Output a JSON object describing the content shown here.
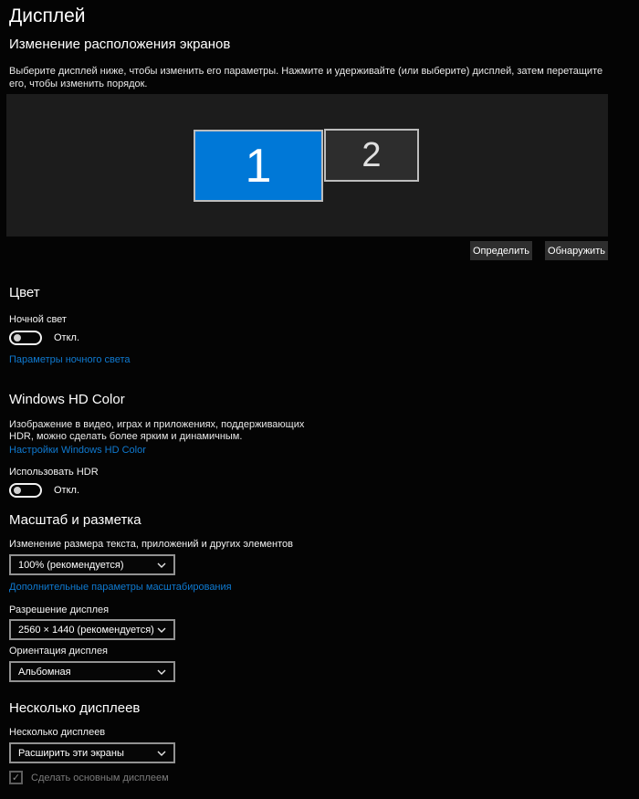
{
  "page": {
    "title": "Дисплей",
    "background": "#040404",
    "panel_color": "#1c1c1c",
    "accent_color": "#0078d7",
    "link_color": "#0f7ad1"
  },
  "arrange": {
    "heading": "Изменение расположения экранов",
    "description": "Выберите дисплей ниже, чтобы изменить его параметры. Нажмите и удерживайте (или выберите) дисплей, затем перетащите его, чтобы изменить порядок.",
    "monitors": [
      {
        "number": "1",
        "selected": true,
        "color": "#0078d7"
      },
      {
        "number": "2",
        "selected": false,
        "color": "#2d2d2d"
      }
    ],
    "identify_button": "Определить",
    "detect_button": "Обнаружить"
  },
  "color_section": {
    "heading": "Цвет",
    "night_light": {
      "label": "Ночной свет",
      "state": "Откл.",
      "on": false
    },
    "link": "Параметры ночного света"
  },
  "hd_color": {
    "heading": "Windows HD Color",
    "description_line1": "Изображение в видео, играх и приложениях, поддерживающих",
    "description_line2": "HDR, можно сделать более ярким и динамичным.",
    "link": "Настройки Windows HD Color",
    "use_hdr": {
      "label": "Использовать HDR",
      "state": "Откл.",
      "on": false
    }
  },
  "scale_layout": {
    "heading": "Масштаб и разметка",
    "scale": {
      "label": "Изменение размера текста, приложений и других элементов",
      "value": "100% (рекомендуется)"
    },
    "link": "Дополнительные параметры масштабирования",
    "resolution": {
      "label": "Разрешение дисплея",
      "value": "2560 × 1440 (рекомендуется)"
    },
    "orientation": {
      "label": "Ориентация дисплея",
      "value": "Альбомная"
    }
  },
  "multiple_displays": {
    "heading": "Несколько дисплеев",
    "mode": {
      "label": "Несколько дисплеев",
      "value": "Расширить эти экраны"
    },
    "make_primary": {
      "label": "Сделать основным дисплеем",
      "checked": true,
      "disabled": true,
      "check_glyph": "✓"
    }
  }
}
